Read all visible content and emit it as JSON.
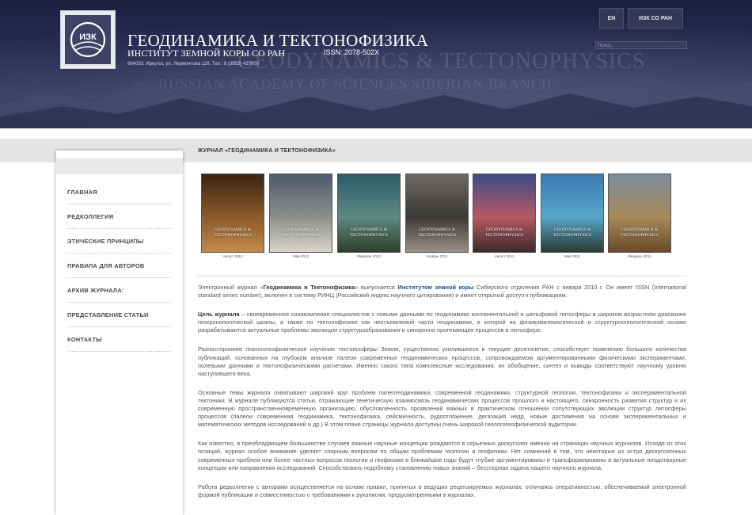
{
  "header": {
    "logo_text": "ИЗК",
    "title": "ГЕОДИНАМИКА И ТЕКТОНОФИЗИКА",
    "subtitle": "ИНСТИТУТ ЗЕМНОЙ КОРЫ СО РАН",
    "issn": "ISSN: 2078-502X",
    "address": "664033, Иркутск, ул. Лермонтова 128, Тел.: 8 (3952) 427000",
    "watermark_1": "GEODYNAMICS & TECTONOPHYSICS",
    "watermark_2": "RUSSIAN ACADEMY OF SCIENCES SIBERIAN BRANCH",
    "lang_button": "EN",
    "institute_button": "ИЗК СО РАН",
    "search_placeholder": "Поиск..."
  },
  "breadcrumb": "ЖУРНАЛ «ГЕОДИНАМИКА И ТЕКТОНОФИЗИКА»",
  "sidebar": {
    "items": [
      {
        "label": "ГЛАВНАЯ"
      },
      {
        "label": "РЕДКОЛЛЕГИЯ"
      },
      {
        "label": "ЭТИЧЕСКИЕ ПРИНЦИПЫ"
      },
      {
        "label": "ПРАВИЛА ДЛЯ АВТОРОВ"
      },
      {
        "label": "АРХИВ ЖУРНАЛА:"
      },
      {
        "label": "ПРЕДСТАВЛЕНИЕ СТАТЬИ"
      },
      {
        "label": "КОНТАКТЫ"
      }
    ]
  },
  "covers": {
    "title_line1": "GEODYNAMICS &",
    "title_line2": "TECTONOPHYSICS",
    "items": [
      {
        "date": "Август 2012",
        "colors": [
          "#3a2412",
          "#8a5a2a",
          "#c48a48"
        ]
      },
      {
        "date": "Май 2012",
        "colors": [
          "#4e5b6c",
          "#8e8f8d",
          "#d8d4cc"
        ]
      },
      {
        "date": "Февраль 2012",
        "colors": [
          "#2c5a68",
          "#5e8a84",
          "#2e3f2a"
        ]
      },
      {
        "date": "Ноябрь 2011",
        "colors": [
          "#6d6a66",
          "#3a3836",
          "#9a8f83"
        ]
      },
      {
        "date": "Август 2011",
        "colors": [
          "#3a4a88",
          "#b65a62",
          "#3d2a2c"
        ]
      },
      {
        "date": "Май 2011",
        "colors": [
          "#3b7ab2",
          "#58a6c9",
          "#2a3a33"
        ]
      },
      {
        "date": "Февраль 2011",
        "colors": [
          "#7a8d9a",
          "#a88a5a",
          "#6a4a2a"
        ]
      }
    ]
  },
  "article": {
    "p1_pre": "Электронный журнал «",
    "p1_journal": "Геодинамика и Тектонофизика",
    "p1_mid": "» выпускается ",
    "p1_link": "Институтом земной коры",
    "p1_post": " Сибирского отделения РАН с января 2010 г. Он имеет ISSN (International standard series number), включен в систему РИНЦ (Российский индекс научного цитирования) и имеет открытый доступ к публикациям.",
    "p2_bold": "Цель журнала",
    "p2_rest": " – своевременное ознакомление специалистов с новыми данными по геодинамике континентальной и шельфовой литосферы в широком возрастном диапазоне геохронологической шкалы, а также по тектонофизике как неотъемлемой части геодинамики, в которой на физикоматематической и структурногеологической основе разрабатываются актуальные проблемы эволюции структурообразования и синхронно протекающих процессов в литосфере.",
    "p3": "Разностороннее геологогеофизическое изучение тектоносферы Земли, существенно усилившееся в текущее десятилетие, способствует появлению большого количества публикаций, основанных на глубоком анализе палеои современных геодинамических процессов, сопровождаемом аргументированными физическими экспериментами, полевыми данными и тектонофизическими расчетами. Именно такого типа комплексные исследования, их обобщение, синтез и выводы соответствуют научному уровню наступившего века.",
    "p4": "Основные темы журнала охватывают широкий круг проблем палеогеодинамики, современной геодинамики, структурной геологии, тектонофизики и экспериментальной тектоники. В журнале публикуются статьи, отражающие генетическую взаимосвязь геодинамических процессов прошлого и настоящего, синхронность развития структур и их современную пространственновременную организацию, обусловленность проявлений важных в практическом отношении сопутствующих эволюции структур литосферы процессов (палеои современная геодинамика, тектонофизика, сейсмичность, рудоотложение, дегазация недр, новые достижения на основе экспериментальных и математических методов исследований и др.) В этом плане страницы журнала доступны очень широкой геологогеофизической аудитории.",
    "p5": "Как известно, в преобладающем большинстве случаев важные научные концепции рождаются в серьезных дискуссиях именно на страницах научных журналов. Исходя из этих позиций, журнал особое внимание уделяет спорным вопросам по общим проблемам геологии и геофизики. Нет сомнений в том, что некоторые из остро дискуссионных современных проблем или более частных вопросов геологии и геофизики в ближайшие годы будут глубже аргументированы и трансформированы в актуальные плодотворные концепции или направления исследований. Способствовать подобному становлению новых знаний – бесспорная задача нашего научного журнала.",
    "p6": "Работа редколлегии с авторами осуществляется на основе правил, принятых в ведущих рецензируемых журналах, отличаясь оперативностью, обеспечиваемой электронной формой публикации и совместимостью с требованиями к рукописям, предусмотренными в журналах."
  }
}
